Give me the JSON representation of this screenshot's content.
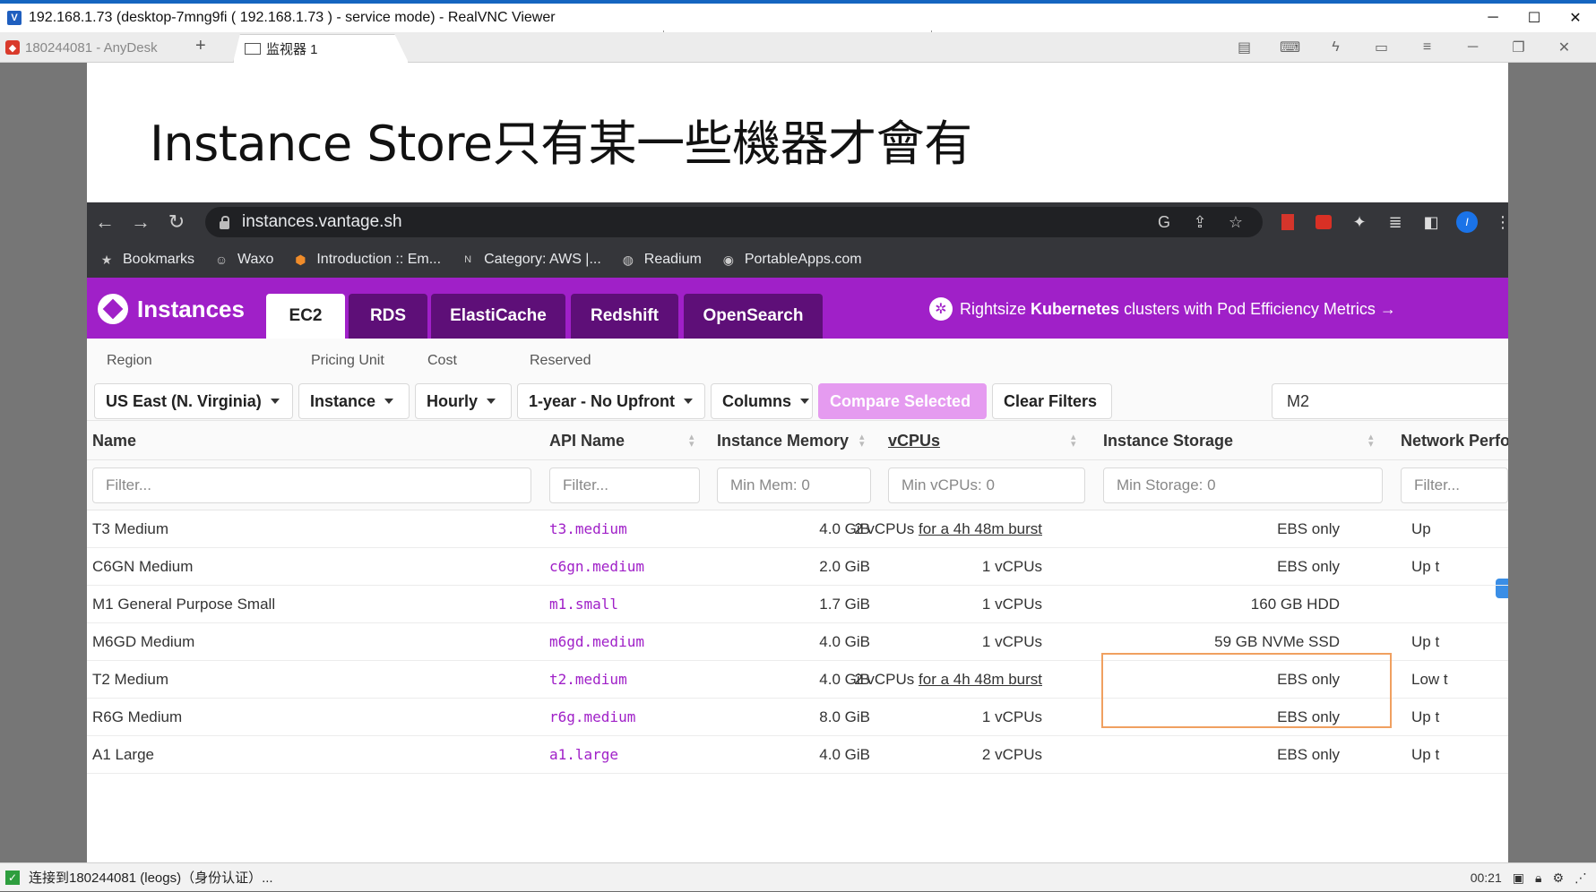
{
  "vnc": {
    "title": "192.168.1.73 (desktop-7mng9fi ( 192.168.1.73 ) - service mode) - RealVNC Viewer",
    "minimize": "─",
    "maximize": "☐",
    "close": "✕"
  },
  "anydesk": {
    "remote_tab": "180244081 - AnyDesk",
    "add_tab": "+",
    "active_tab": "监视器 1",
    "tools": [
      "chat-icon",
      "keyboard-icon",
      "lightning-icon",
      "monitor-icon",
      "menu-icon",
      "minimize-icon",
      "restore-icon",
      "close-icon"
    ]
  },
  "slide": {
    "title": "Instance Store只有某一些機器才會有"
  },
  "browser": {
    "url": "instances.vantage.sh",
    "profile_initial": "I",
    "bookmarks": [
      {
        "label": "Bookmarks",
        "icon": "star-icon"
      },
      {
        "label": "Waxo",
        "icon": "waxo-icon"
      },
      {
        "label": "Introduction :: Em...",
        "icon": "cube-icon"
      },
      {
        "label": "Category: AWS |...",
        "icon": "n-icon"
      },
      {
        "label": "Readium",
        "icon": "globe-icon"
      },
      {
        "label": "PortableApps.com",
        "icon": "portableapps-icon"
      }
    ]
  },
  "app": {
    "brand": "Instances",
    "tabs": [
      "EC2",
      "RDS",
      "ElastiCache",
      "Redshift",
      "OpenSearch"
    ],
    "active_tab": "EC2",
    "promo": {
      "pre": "Rightsize",
      "bold": "Kubernetes",
      "post": "clusters with Pod Efficiency Metrics →"
    },
    "accent": "#a020c8"
  },
  "filters": {
    "region_label": "Region",
    "region_value": "US East (N. Virginia)",
    "pricing_label": "Pricing Unit",
    "pricing_value": "Instance",
    "cost_label": "Cost",
    "cost_value": "Hourly",
    "reserved_label": "Reserved",
    "reserved_value": "1-year - No Upfront",
    "columns": "Columns",
    "compare": "Compare Selected",
    "clear": "Clear Filters",
    "search_value": "M2"
  },
  "table": {
    "headers": {
      "name": "Name",
      "api": "API Name",
      "memory": "Instance Memory",
      "vcpus": "vCPUs",
      "storage": "Instance Storage",
      "network": "Network Perfo"
    },
    "filter_placeholders": {
      "name": "Filter...",
      "api": "Filter...",
      "memory": "Min Mem: 0",
      "vcpus": "Min vCPUs: 0",
      "storage": "Min Storage: 0",
      "network": "Filter..."
    },
    "rows": [
      {
        "name": "T3 Medium",
        "api": "t3.medium",
        "memory": "4.0 GiB",
        "vcpu": "2 vCPUs",
        "burst": "for a 4h 48m burst",
        "storage": "EBS only",
        "network": "Up"
      },
      {
        "name": "C6GN Medium",
        "api": "c6gn.medium",
        "memory": "2.0 GiB",
        "vcpu": "1 vCPUs",
        "burst": "",
        "storage": "EBS only",
        "network": "Up t"
      },
      {
        "name": "M1 General Purpose Small",
        "api": "m1.small",
        "memory": "1.7 GiB",
        "vcpu": "1 vCPUs",
        "burst": "",
        "storage": "160 GB HDD",
        "network": ""
      },
      {
        "name": "M6GD Medium",
        "api": "m6gd.medium",
        "memory": "4.0 GiB",
        "vcpu": "1 vCPUs",
        "burst": "",
        "storage": "59 GB NVMe SSD",
        "network": "Up t"
      },
      {
        "name": "T2 Medium",
        "api": "t2.medium",
        "memory": "4.0 GiB",
        "vcpu": "2 vCPUs",
        "burst": "for a 4h 48m burst",
        "storage": "EBS only",
        "network": "Low t"
      },
      {
        "name": "R6G Medium",
        "api": "r6g.medium",
        "memory": "8.0 GiB",
        "vcpu": "1 vCPUs",
        "burst": "",
        "storage": "EBS only",
        "network": "Up t"
      },
      {
        "name": "A1 Large",
        "api": "a1.large",
        "memory": "4.0 GiB",
        "vcpu": "2 vCPUs",
        "burst": "",
        "storage": "EBS only",
        "network": "Up t"
      }
    ]
  },
  "status": {
    "text": "连接到180244081 (leogs)（身份认证）...",
    "time": "00:21"
  }
}
